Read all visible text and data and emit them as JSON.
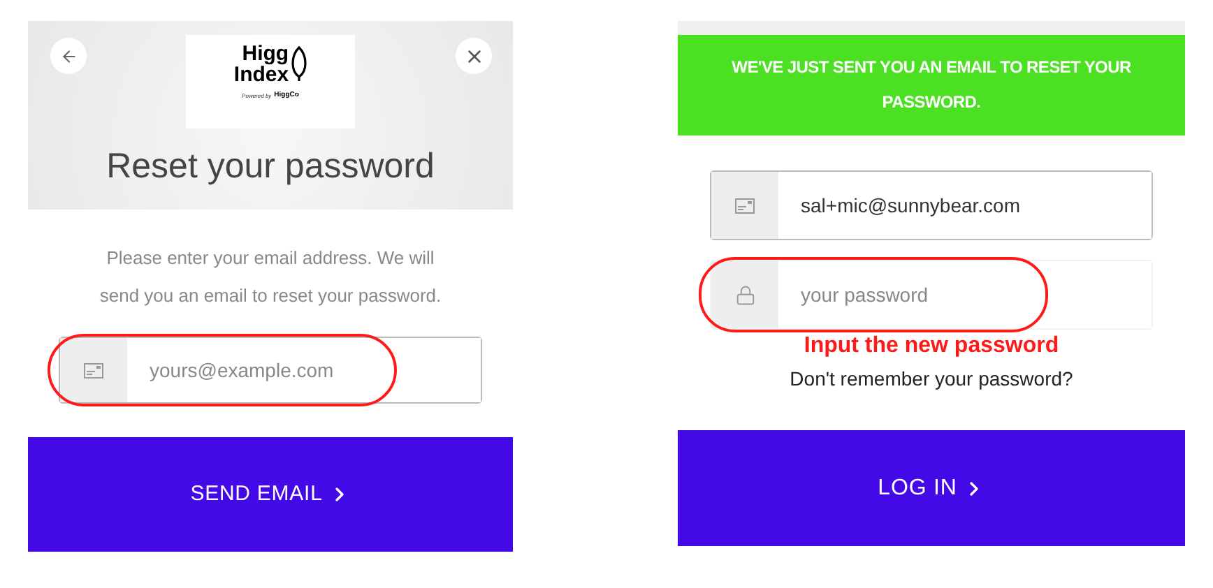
{
  "reset_panel": {
    "logo": {
      "line_1": "Higg",
      "line_2": "Index",
      "tagline": "Powered by",
      "brand": "HiggCo"
    },
    "title": "Reset your password",
    "description": "Please enter your email address. We will send you an email to reset your password.",
    "email_field": {
      "placeholder": "yours@example.com",
      "highlighted": true
    },
    "button": "SEND EMAIL"
  },
  "login_panel": {
    "banner": "WE'VE JUST SENT YOU AN EMAIL TO RESET YOUR PASSWORD.",
    "fields": [
      {
        "kind": "email",
        "value": "sal+mic@sunnybear.com",
        "highlighted": false
      },
      {
        "kind": "password",
        "placeholder": "your password",
        "highlighted": true
      }
    ],
    "annotation": "Input the new password",
    "forgot_link": "Don't remember your password?",
    "button": "LOG IN"
  }
}
